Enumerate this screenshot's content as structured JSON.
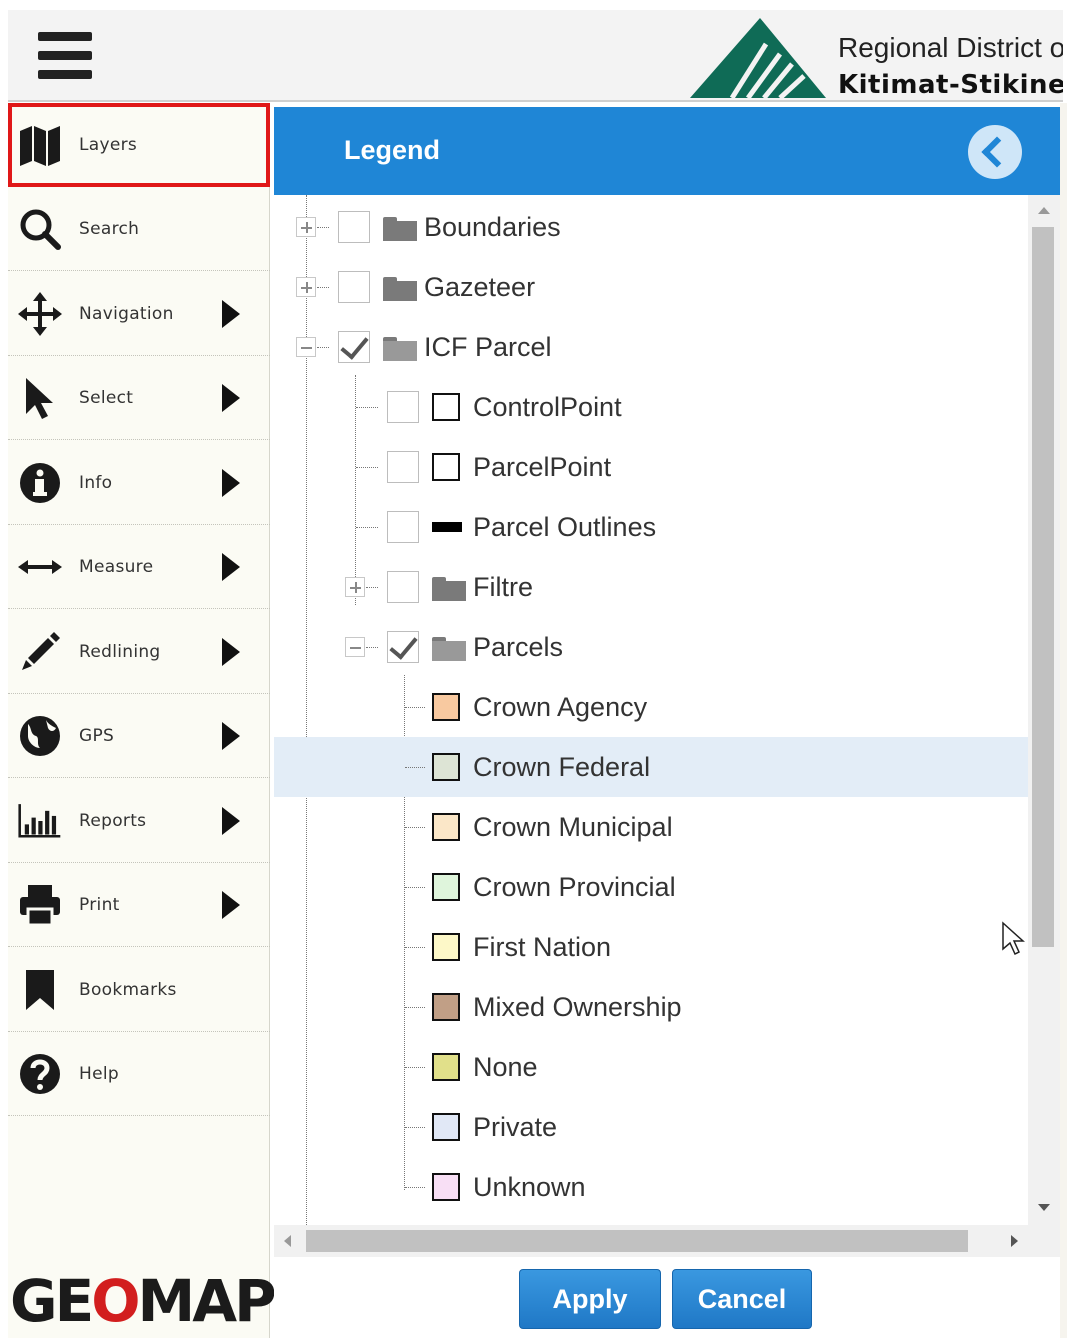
{
  "header": {
    "logo_line1": "Regional District of",
    "logo_line2": "Kitimat-Stikine",
    "brand_color": "#0f6b56"
  },
  "sidebar": {
    "items": [
      {
        "label": "Layers",
        "icon": "map-icon",
        "has_submenu": false,
        "selected": true
      },
      {
        "label": "Search",
        "icon": "search-icon",
        "has_submenu": false
      },
      {
        "label": "Navigation",
        "icon": "move-arrows-icon",
        "has_submenu": true
      },
      {
        "label": "Select",
        "icon": "pointer-icon",
        "has_submenu": true
      },
      {
        "label": "Info",
        "icon": "info-icon",
        "has_submenu": true
      },
      {
        "label": "Measure",
        "icon": "measure-icon",
        "has_submenu": true
      },
      {
        "label": "Redlining",
        "icon": "pencil-icon",
        "has_submenu": true
      },
      {
        "label": "GPS",
        "icon": "globe-icon",
        "has_submenu": true
      },
      {
        "label": "Reports",
        "icon": "bar-chart-icon",
        "has_submenu": true
      },
      {
        "label": "Print",
        "icon": "printer-icon",
        "has_submenu": true
      },
      {
        "label": "Bookmarks",
        "icon": "bookmark-icon",
        "has_submenu": false
      },
      {
        "label": "Help",
        "icon": "help-icon",
        "has_submenu": false
      }
    ],
    "footer_logo": {
      "pre": "GE",
      "o": "O",
      "post": "MAP"
    }
  },
  "legend": {
    "title": "Legend",
    "header_color": "#1f86d6",
    "tree": [
      {
        "label": "Boundaries",
        "level": 0,
        "type": "folder",
        "expander": "plus",
        "checked": false
      },
      {
        "label": "Gazeteer",
        "level": 0,
        "type": "folder",
        "expander": "plus",
        "checked": false
      },
      {
        "label": "ICF Parcel",
        "level": 0,
        "type": "folder-open",
        "expander": "minus",
        "checked": true
      },
      {
        "label": "ControlPoint",
        "level": 1,
        "type": "swatch",
        "color": "#ffffff",
        "checked": false
      },
      {
        "label": "ParcelPoint",
        "level": 1,
        "type": "swatch",
        "color": "#ffffff",
        "checked": false
      },
      {
        "label": "Parcel Outlines",
        "level": 1,
        "type": "line",
        "color": "#000000",
        "checked": false
      },
      {
        "label": "Filtre",
        "level": 1,
        "type": "folder",
        "expander": "plus",
        "checked": false
      },
      {
        "label": "Parcels",
        "level": 1,
        "type": "folder-open",
        "expander": "minus",
        "checked": true
      },
      {
        "label": "Crown Agency",
        "level": 2,
        "type": "swatch",
        "color": "#f8c9a0"
      },
      {
        "label": "Crown Federal",
        "level": 2,
        "type": "swatch",
        "color": "#dde4d5",
        "highlighted": true
      },
      {
        "label": "Crown Municipal",
        "level": 2,
        "type": "swatch",
        "color": "#fbe7c8"
      },
      {
        "label": "Crown Provincial",
        "level": 2,
        "type": "swatch",
        "color": "#dff5dc"
      },
      {
        "label": "First Nation",
        "level": 2,
        "type": "swatch",
        "color": "#fdf8c8"
      },
      {
        "label": "Mixed Ownership",
        "level": 2,
        "type": "swatch",
        "color": "#c19f86"
      },
      {
        "label": "None",
        "level": 2,
        "type": "swatch",
        "color": "#e1e08a"
      },
      {
        "label": "Private",
        "level": 2,
        "type": "swatch",
        "color": "#e1e8f6"
      },
      {
        "label": "Unknown",
        "level": 2,
        "type": "swatch",
        "color": "#f8dff5"
      }
    ]
  },
  "footer": {
    "apply_label": "Apply",
    "cancel_label": "Cancel"
  }
}
